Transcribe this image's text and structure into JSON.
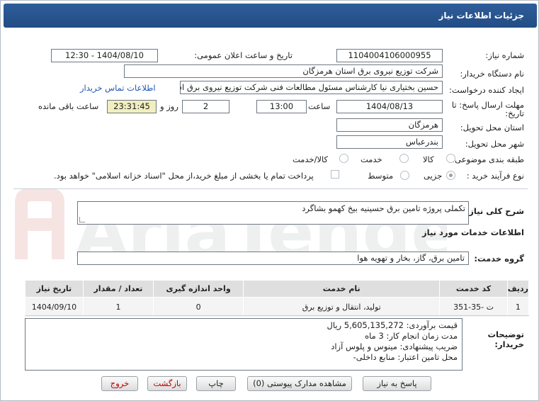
{
  "window_title": "جزئیات اطلاعات نیاز",
  "fields": {
    "need_number_label": "شماره نیاز:",
    "need_number": "1104004106000955",
    "announce_label": "تاریخ و ساعت اعلان عمومی:",
    "announce_value": "1404/08/10 - 12:30",
    "buyer_org_label": "نام دستگاه خریدار:",
    "buyer_org": "شرکت توزیع نیروی برق استان هرمزگان",
    "creator_label": "ایجاد کننده درخواست:",
    "creator": "حسین بختیاری نیا کارشناس مسئول مطالعات فنی شرکت توزیع نیروی برق استان هرمزگان",
    "contact_link": "اطلاعات تماس خریدار",
    "deadline_label_1": "مهلت ارسال پاسخ: تا",
    "deadline_label_2": "تاریخ:",
    "deadline_date": "1404/08/13",
    "time_label": "ساعت",
    "deadline_time": "13:00",
    "days_value": "2",
    "days_label": "روز و",
    "remaining_value": "23:31:45",
    "remaining_label": "ساعت باقی مانده",
    "province_label": "استان محل تحویل:",
    "province": "هرمزگان",
    "city_label": "شهر محل تحویل:",
    "city": "بندرعباس",
    "category_label": "طبقه بندی موضوعی:",
    "category_options": [
      "کالا",
      "خدمت",
      "کالا/خدمت"
    ],
    "process_label": "نوع فرآیند خرید :",
    "process_options": [
      "جزیی",
      "متوسط"
    ],
    "payment_note": "پرداخت تمام یا بخشی از مبلغ خرید،از محل \"اسناد خزانه اسلامی\" خواهد بود."
  },
  "summary": {
    "label": "شرح کلی نیاز:",
    "text": "تکملی پروژه تامین برق حسینیه بیخ کهمو بشاگرد"
  },
  "services": {
    "section_title": "اطلاعات خدمات مورد نیاز",
    "group_label": "گروه خدمت:",
    "group_value": "تامین برق، گاز، بخار و تهویه هوا",
    "columns": [
      "ردیف",
      "کد خدمت",
      "نام خدمت",
      "واحد اندازه گیری",
      "تعداد / مقدار",
      "تاریخ نیاز"
    ],
    "rows": [
      [
        "1",
        "ت -35-351",
        "تولید، انتقال و توزیع برق",
        "0",
        "1",
        "1404/09/10"
      ]
    ]
  },
  "buyer_notes": {
    "label_1": "توضیحات",
    "label_2": "خریدار:",
    "lines": [
      "قیمت برآوردی:  5,605,135,272 ریال",
      "مدت زمان انجام کار: 3 ماه",
      "ضریب پیشنهادی: مینوس و پلوس آزاد",
      "محل تامین اعتبار: منابع داخلی-"
    ]
  },
  "buttons": {
    "reply": "پاسخ به نیاز",
    "attachments": "مشاهده مدارک پیوستی (0)",
    "print": "چاپ",
    "back": "بازگشت",
    "exit": "خروج"
  },
  "watermark": "AriaTender.net",
  "colors": {
    "title_bar": "#2a5790",
    "highlight": "#f1eebf",
    "link": "#1f57b5",
    "watermark": "#c0392b"
  }
}
